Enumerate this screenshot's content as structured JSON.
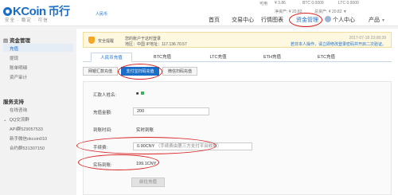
{
  "brand": {
    "logo_text": "KCoin",
    "logo_cn": "币行",
    "tagline": "安全 · 稳定 · 可信",
    "username": "人民币"
  },
  "stats": {
    "row1": [
      {
        "label": "可用",
        "value": ""
      },
      {
        "label": "¥",
        "value": "3.86"
      },
      {
        "label": "BTC",
        "value": "0.0009"
      },
      {
        "label": "LTC",
        "value": "0.0000"
      }
    ],
    "row2": [
      {
        "label": "净资产",
        "value": "¥ 20.82"
      },
      {
        "label": "总资产",
        "value": "¥ 20.82"
      }
    ]
  },
  "nav": {
    "items": [
      "首页",
      "交易中心",
      "行情图表",
      "资金管理",
      "个人中心",
      "产品"
    ],
    "active": "资金管理"
  },
  "sidebar": {
    "section1_title": "资金管理",
    "section1_items": [
      "充值",
      "提现",
      "账单明细",
      "资产审计"
    ],
    "active_item": "充值",
    "section2_title": "服务支持",
    "section2_items": [
      "在线咨询",
      "QQ交流群",
      "API群529057533",
      "新手微信okcoin010",
      "合约群531307150"
    ]
  },
  "notice": {
    "label": "安全提醒",
    "line1": "您的账户于这时登录",
    "line2": "地区：中国   IP地址：117.136.70.57",
    "date": "2017-07-18 23:08:39",
    "warning": "若非本人操作，请立即修改登录密码并开启二次验证。"
  },
  "tabs": [
    "人民币充值",
    "BTC充值",
    "LTC充值",
    "ETH充值",
    "ETC充值"
  ],
  "active_tab": "人民币充值",
  "subtabs": [
    "网银汇款充值",
    "支付宝扫码充值",
    "微信扫码充值"
  ],
  "active_subtab": "支付宝扫码充值",
  "form": {
    "payer_label": "汇款人姓名:",
    "payer_value": "■",
    "amount_label": "充值金额:",
    "amount_value": "200",
    "arrival_time_label": "到账时间:",
    "arrival_time_value": "实时到账",
    "fee_label": "手续费:",
    "fee_value": "0.90CNY",
    "fee_note": "（手续费由第三方支付平台收取）",
    "actual_label": "实际到账:",
    "actual_value": "199.1CNY",
    "submit_label": "前往充值"
  },
  "colors": {
    "accent": "#1a6ec8",
    "circle": "#d71f1f",
    "notice_bg": "#fff8e1"
  }
}
